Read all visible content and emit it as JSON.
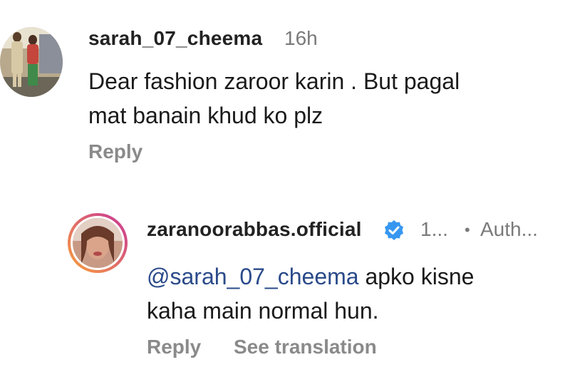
{
  "comments": [
    {
      "username": "sarah_07_cheema",
      "time": "16h",
      "lines": [
        "Dear fashion zaroor karin . But pagal",
        "mat banain khud ko plz"
      ],
      "actions": {
        "reply": "Reply"
      }
    }
  ],
  "reply": {
    "username": "zaranoorabbas.official",
    "verified": true,
    "time": "1...",
    "separator": "•",
    "author_tag": "Auth...",
    "mention": "@sarah_07_cheema",
    "line1_rest": " apko kisne",
    "line2": "kaha main normal hun.",
    "actions": {
      "reply": "Reply",
      "see_translation": "See translation"
    }
  },
  "colors": {
    "verified_badge": "#3797f0",
    "story_ring_start": "#f9a13a",
    "story_ring_end": "#c73599",
    "mention": "#2a4a8a"
  }
}
